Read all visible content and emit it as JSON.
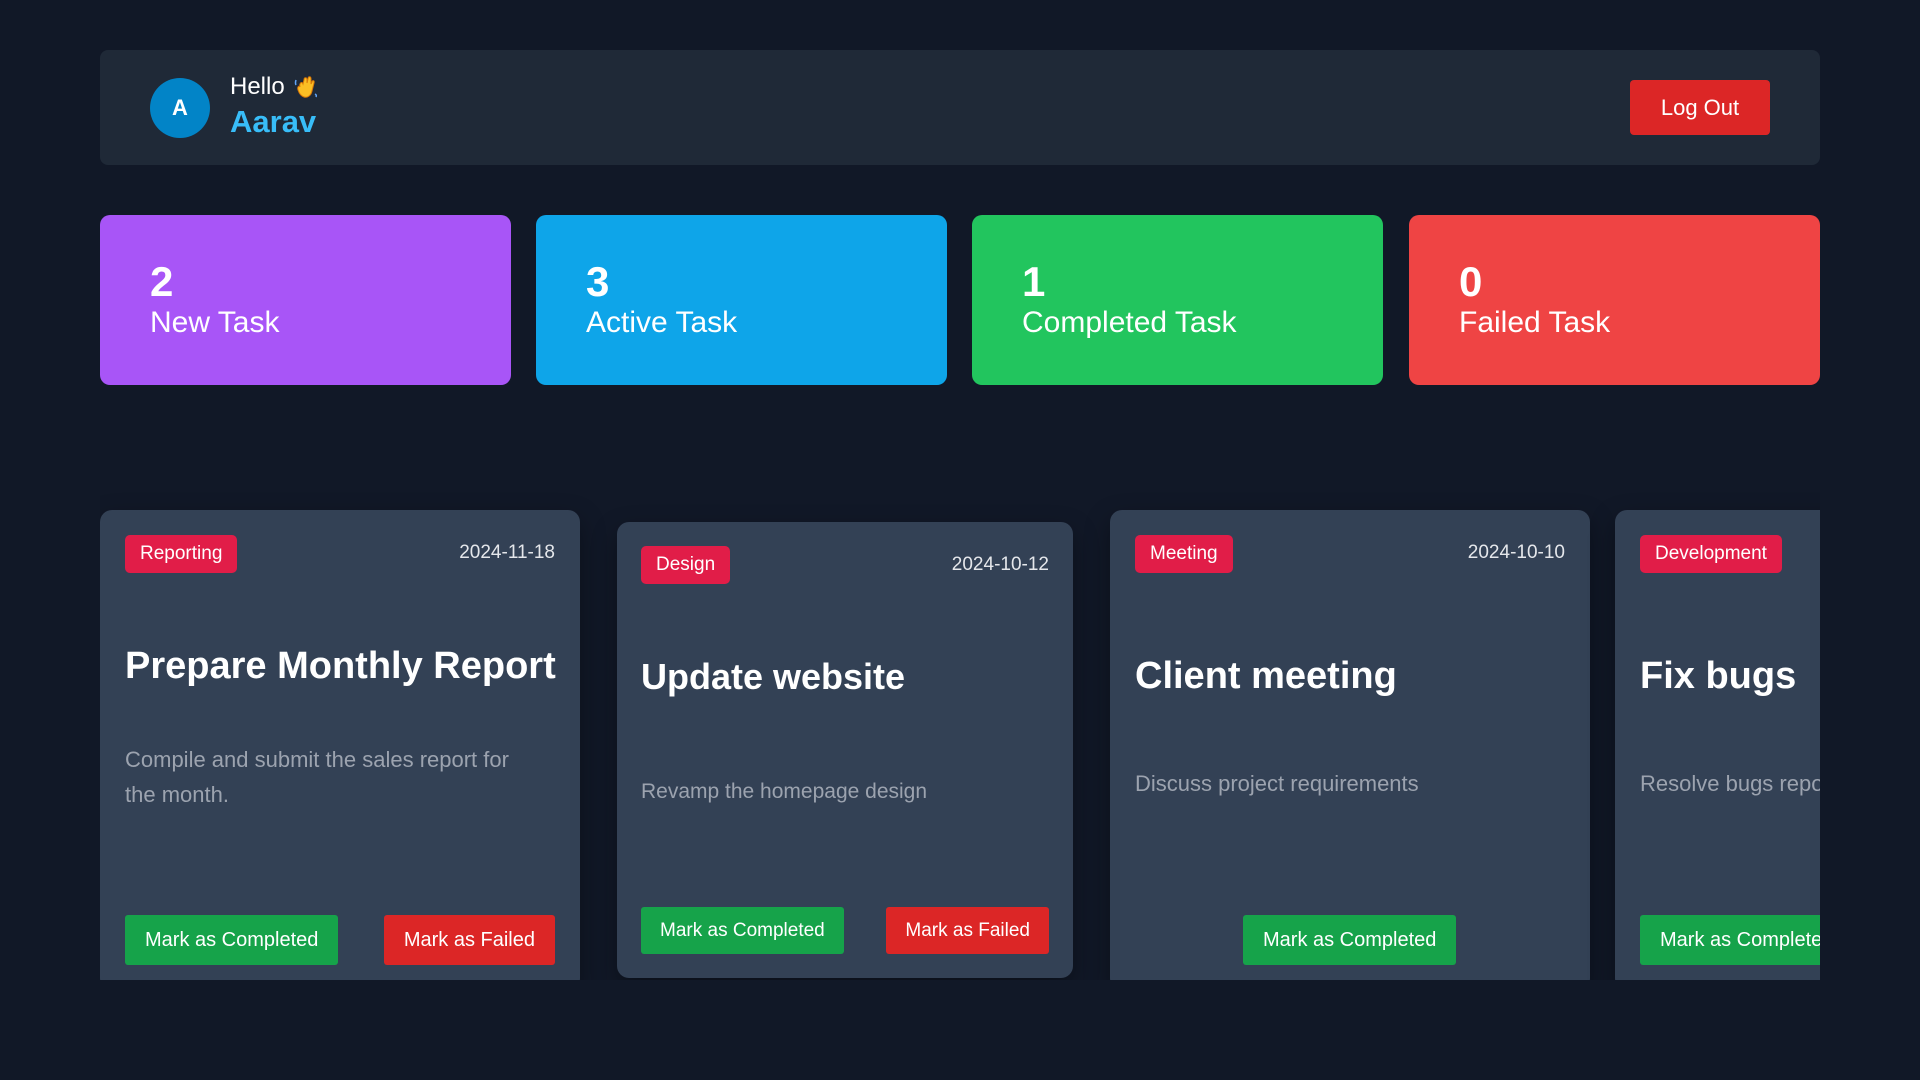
{
  "header": {
    "avatar_initial": "A",
    "greeting": "Hello",
    "user_name": "Aarav",
    "logout_label": "Log Out"
  },
  "stats": [
    {
      "count": "2",
      "label": "New Task",
      "color": "#a855f7"
    },
    {
      "count": "3",
      "label": "Active Task",
      "color": "#0ea5e9"
    },
    {
      "count": "1",
      "label": "Completed Task",
      "color": "#22c55e"
    },
    {
      "count": "0",
      "label": "Failed Task",
      "color": "#ef4444"
    }
  ],
  "tasks": [
    {
      "category": "Reporting",
      "date": "2024-11-18",
      "title": "Prepare Monthly Report",
      "description": "Compile and submit the sales report for the month.",
      "complete_label": "Mark as Completed",
      "fail_label": "Mark as Failed"
    },
    {
      "category": "Design",
      "date": "2024-10-12",
      "title": "Update website",
      "description": "Revamp the homepage design",
      "complete_label": "Mark as Completed",
      "fail_label": "Mark as Failed"
    },
    {
      "category": "Meeting",
      "date": "2024-10-10",
      "title": "Client meeting",
      "description": "Discuss project requirements",
      "complete_label": "Mark as Completed"
    },
    {
      "category": "Development",
      "title": "Fix bugs",
      "description": "Resolve bugs reported",
      "complete_label": "Mark as Completed"
    }
  ],
  "icons": {
    "wave": "waving-hand-icon"
  }
}
